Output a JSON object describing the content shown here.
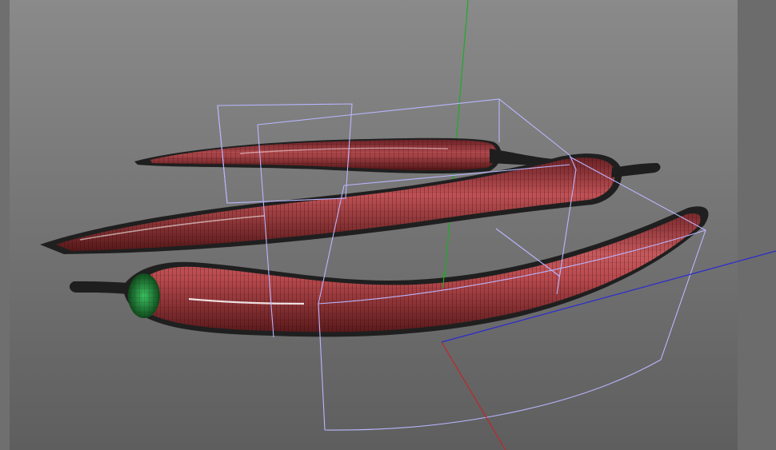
{
  "viewport": {
    "view": "perspective",
    "colors": {
      "background_top": "#8a8a8a",
      "background_bottom": "#5e5e5e",
      "side_panel": "#6c6c6c",
      "pepper_red": "#b84a4e",
      "pepper_dark": "#5a1a1c",
      "wire": "#2a0a0a",
      "stem": "#1e1e1e",
      "calyx_green": "#1f8a3a",
      "bounding_box": "#b9b6ff",
      "axis_x": "#c0262a",
      "axis_y": "#1faa2a",
      "axis_z": "#2a2ad0"
    }
  },
  "scene": {
    "objects": [
      {
        "name": "chili-pepper-back"
      },
      {
        "name": "chili-pepper-middle"
      },
      {
        "name": "chili-pepper-front"
      }
    ],
    "gizmo": {
      "axes": [
        "x",
        "y",
        "z"
      ]
    }
  }
}
